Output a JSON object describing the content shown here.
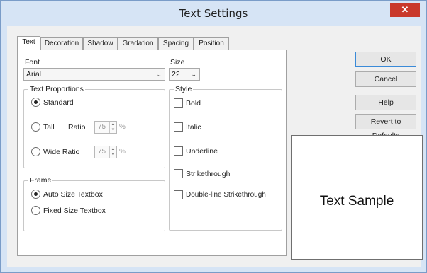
{
  "window": {
    "title": "Text Settings"
  },
  "tabs": [
    "Text",
    "Decoration",
    "Shadow",
    "Gradation",
    "Spacing",
    "Position"
  ],
  "active_tab": "Text",
  "font": {
    "label": "Font",
    "value": "Arial"
  },
  "size": {
    "label": "Size",
    "value": "22"
  },
  "text_proportions": {
    "title": "Text Proportions",
    "standard": "Standard",
    "tall": "Tall",
    "tall_ratio_label": "Ratio",
    "tall_ratio_value": "75",
    "wide": "Wide Ratio",
    "wide_ratio_value": "75",
    "percent": "%",
    "selected": "Standard"
  },
  "style": {
    "title": "Style",
    "bold": "Bold",
    "italic": "Italic",
    "underline": "Underline",
    "strikethrough": "Strikethrough",
    "double_strike": "Double-line Strikethrough"
  },
  "frame": {
    "title": "Frame",
    "auto": "Auto Size Textbox",
    "fixed": "Fixed Size Textbox",
    "selected": "Auto Size Textbox"
  },
  "buttons": {
    "ok": "OK",
    "cancel": "Cancel",
    "help": "Help",
    "revert": "Revert to Defaults"
  },
  "sample": {
    "text": "Text Sample"
  },
  "colors": {
    "title_bg": "#d6e4f5",
    "close_bg": "#c9392b",
    "face": "#f0f0f0"
  }
}
